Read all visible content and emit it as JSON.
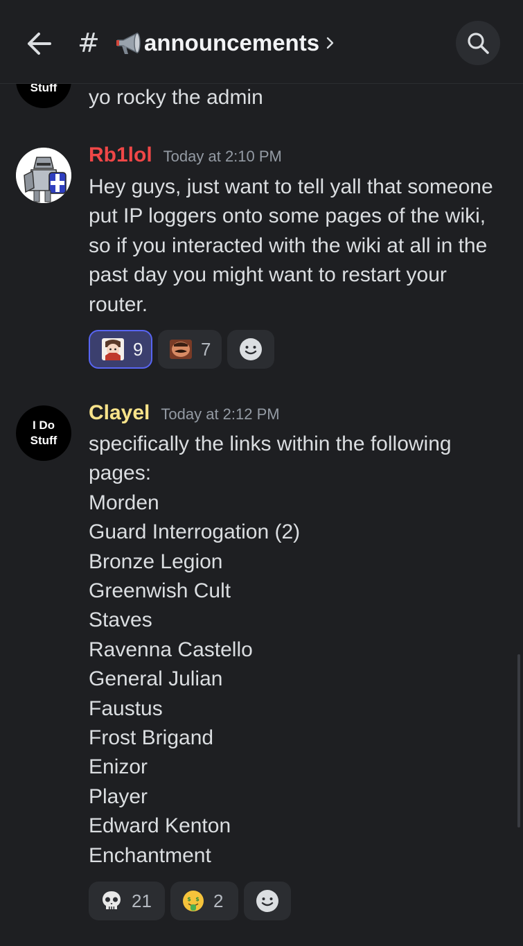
{
  "header": {
    "channel_hash": "#",
    "channel_name": "announcements",
    "channel_icon": "megaphone-icon",
    "back_icon": "arrow-left-icon",
    "search_icon": "search-icon"
  },
  "messages": [
    {
      "id": "partial",
      "avatar_text_line2": "Stuff",
      "lines": [
        "yo rocky the admin"
      ]
    },
    {
      "id": "rb1lol",
      "username": "Rb1lol",
      "username_color": "#f04747",
      "timestamp": "Today at 2:10 PM",
      "lines": [
        "Hey guys, just want to tell yall that someone",
        "put IP loggers onto some pages of the wiki,",
        "so if you interacted with the wiki at all in the",
        "past day you might want to restart your",
        "router."
      ],
      "reactions": [
        {
          "emoji": "character-face-emoji",
          "count": "9",
          "active": true
        },
        {
          "emoji": "mustache-face-emoji",
          "count": "7",
          "active": false
        }
      ]
    },
    {
      "id": "clayel",
      "username": "Clayel",
      "username_color": "#f8e38a",
      "timestamp": "Today at 2:12 PM",
      "avatar_text_line1": "I Do",
      "avatar_text_line2": "Stuff",
      "lines": [
        "specifically the links within the following",
        "pages:",
        "Morden",
        "Guard Interrogation (2)",
        "Bronze Legion",
        "Greenwish Cult",
        "Staves",
        "Ravenna Castello",
        "General Julian",
        "Faustus",
        "Frost Brigand",
        "Enizor",
        "Player",
        "Edward Kenton",
        "Enchantment"
      ],
      "reactions": [
        {
          "emoji": "skull-emoji",
          "count": "21",
          "active": false
        },
        {
          "emoji": "money-mouth-face-emoji",
          "count": "2",
          "active": false
        }
      ]
    }
  ]
}
